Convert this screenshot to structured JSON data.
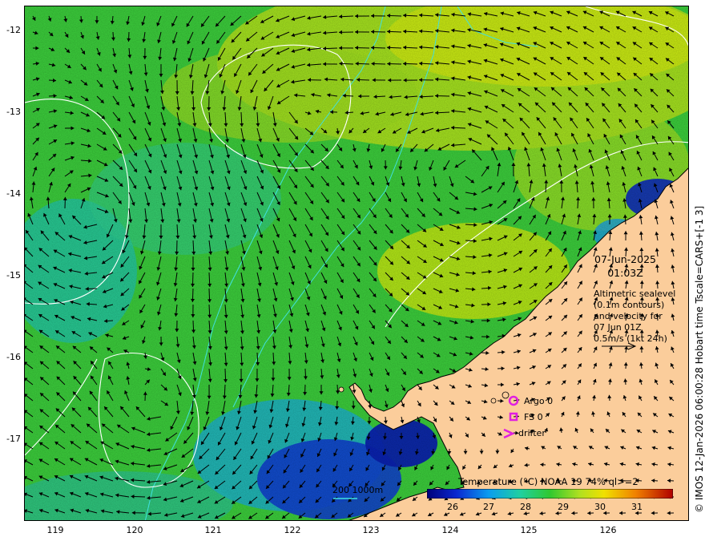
{
  "map": {
    "y_ticks": [
      "-12",
      "-13",
      "-14",
      "-15",
      "-16",
      "-17"
    ],
    "x_ticks": [
      "119",
      "120",
      "121",
      "122",
      "123",
      "124",
      "125",
      "126"
    ],
    "lon_range": [
      118.6,
      127.0
    ],
    "lat_range": [
      -17.95,
      -11.7
    ]
  },
  "info": {
    "date": "07-Jun-2025",
    "time": "01:03Z",
    "desc_lines": [
      "Altimetric sealevel",
      "(0.1m contours)",
      "and velocity for",
      "07 Jun 01Z",
      "0.5m/s (1kt 24h)"
    ]
  },
  "markers": {
    "argo": "Argo 0",
    "fs": "FS 0",
    "drifter": "drifter",
    "color": "#e020e0"
  },
  "scale": {
    "label": "200  1000m",
    "color": "#40e0e0"
  },
  "colorbar": {
    "title": "Temperature (°C) NOAA 19 74% ql>=2",
    "ticks": [
      "26",
      "27",
      "28",
      "29",
      "30",
      "31"
    ],
    "range": [
      25.2,
      32.0
    ]
  },
  "credit": "© IMOS 12-Jan-2026 06:00:28 Hobart time Tscale=CARS+[-1 3]",
  "colors": {
    "land": "#fbcd9b",
    "sea_warm": "#d6f000",
    "sea_cool": "#1a1aa0"
  }
}
